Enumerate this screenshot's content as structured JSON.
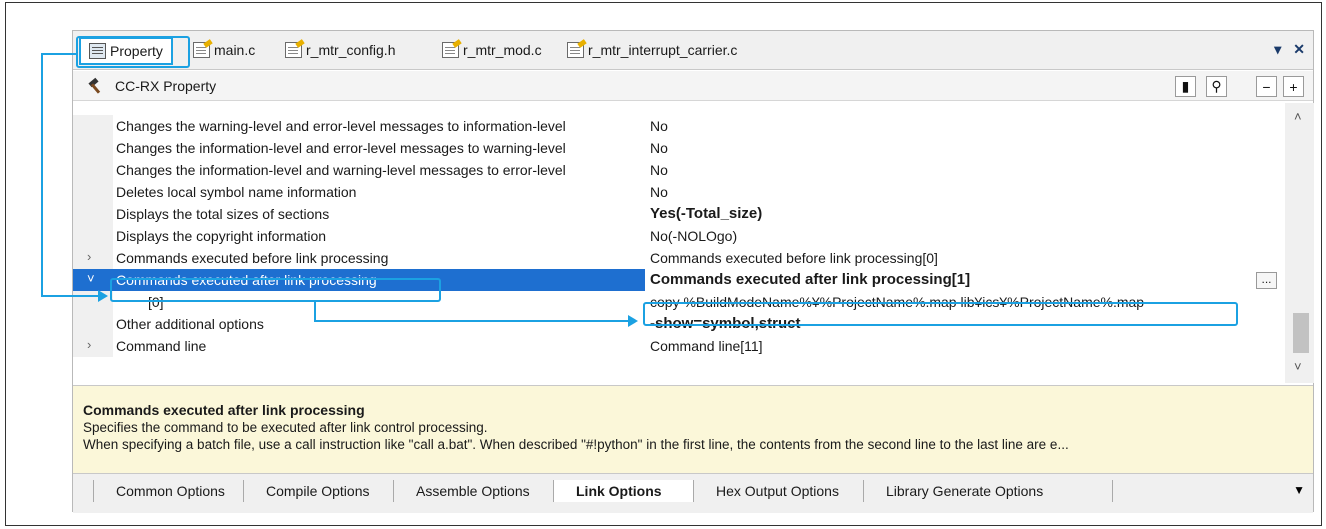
{
  "tabs": [
    {
      "label": "Property",
      "icon": "property-icon"
    },
    {
      "label": "main.c",
      "icon": "file-icon"
    },
    {
      "label": "r_mtr_config.h",
      "icon": "file-icon"
    },
    {
      "label": "r_mtr_mod.c",
      "icon": "file-icon"
    },
    {
      "label": "r_mtr_interrupt_carrier.c",
      "icon": "file-icon"
    }
  ],
  "tab_controls": {
    "dropdown": "▾",
    "close": "✕"
  },
  "header": {
    "title": "CC-RX Property",
    "lock": "▮",
    "search": "⚲",
    "collapse": "−",
    "expand": "+"
  },
  "rows": [
    {
      "name": "Changes the warning-level and error-level messages to information-level",
      "value": "No"
    },
    {
      "name": "Changes the information-level and error-level messages to warning-level",
      "value": "No"
    },
    {
      "name": "Changes the information-level and warning-level messages to error-level",
      "value": "No"
    },
    {
      "name": "Deletes local symbol name information",
      "value": "No"
    },
    {
      "name": "Displays the total sizes of sections",
      "value": "Yes(-Total_size)"
    },
    {
      "name": "Displays the copyright information",
      "value": "No(-NOLOgo)"
    },
    {
      "name": "Commands executed before link processing",
      "value": "Commands executed before link processing[0]",
      "expander": "›"
    },
    {
      "name": "Commands executed after link processing",
      "value": "Commands executed after link processing[1]",
      "expander": "˅",
      "ellipsis": "..."
    },
    {
      "name": "[0]",
      "value": "copy %BuildModeName%¥%ProjectName%.map lib¥ics¥%ProjectName%.map"
    },
    {
      "name": "Other additional options",
      "value": "-show=symbol,struct"
    },
    {
      "name": "Command line",
      "value": "Command line[11]",
      "expander": "›"
    }
  ],
  "description": {
    "title": "Commands executed after link processing",
    "line1": "Specifies the command to be executed after link control processing.",
    "line2": "When specifying a batch file, use a call instruction like \"call a.bat\". When described \"#!python\" in the first line, the contents from the second line to the last line are e..."
  },
  "bottom_tabs": [
    "Common Options",
    "Compile Options",
    "Assemble Options",
    "Link Options",
    "Hex Output Options",
    "Library Generate Options"
  ],
  "bottom_arrow": "▼",
  "scroll": {
    "up": "˄",
    "down": "˅"
  },
  "colors": {
    "accent": "#1ba1e2",
    "selection": "#1e6fd0",
    "description_bg": "#fbf7d9"
  }
}
